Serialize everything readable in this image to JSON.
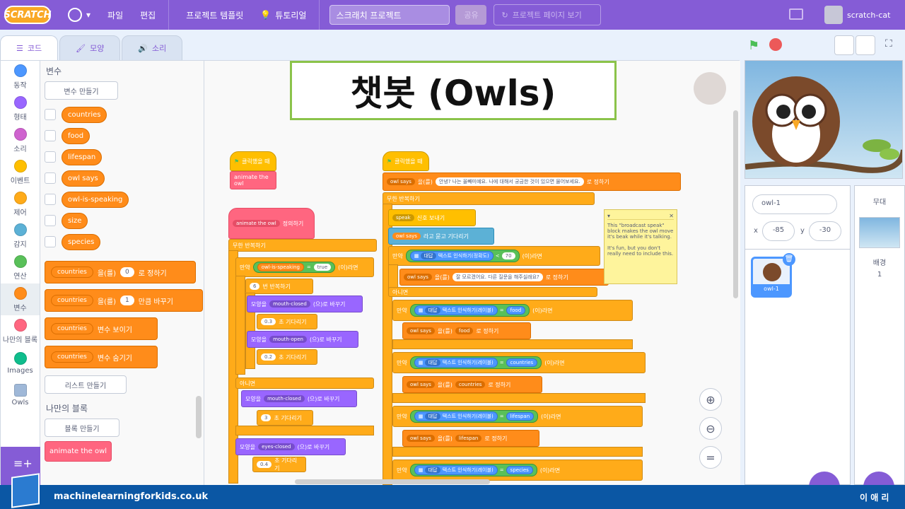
{
  "menubar": {
    "logo": "SCRATCH",
    "file": "파일",
    "edit": "편집",
    "templates": "프로젝트 템플릿",
    "tutorials": "튜토리얼",
    "project_title": "스크래치 프로젝트",
    "share": "공유",
    "see_project": "프로젝트 페이지 보기",
    "username": "scratch-cat"
  },
  "tabs": {
    "code": "코드",
    "costumes": "모양",
    "sounds": "소리"
  },
  "categories": [
    {
      "label": "동작",
      "color": "#4c97ff"
    },
    {
      "label": "형태",
      "color": "#9966ff"
    },
    {
      "label": "소리",
      "color": "#cf63cf"
    },
    {
      "label": "이벤트",
      "color": "#ffbf00"
    },
    {
      "label": "제어",
      "color": "#ffab19"
    },
    {
      "label": "감지",
      "color": "#5cb1d6"
    },
    {
      "label": "연산",
      "color": "#59c059"
    },
    {
      "label": "변수",
      "color": "#ff8c1a"
    },
    {
      "label": "나만의 블록",
      "color": "#ff6680"
    },
    {
      "label": "Images",
      "color": "#0fbd8c"
    },
    {
      "label": "Owls",
      "color": "#9fb8d8"
    }
  ],
  "palette": {
    "heading": "변수",
    "make_variable": "변수 만들기",
    "variables": [
      "countries",
      "food",
      "lifespan",
      "owl says",
      "owl-is-speaking",
      "size",
      "species"
    ],
    "set_var": "countries",
    "set_label": "을(를)",
    "set_value": "0",
    "set_suffix": "로 정하기",
    "change_var": "countries",
    "change_value": "1",
    "change_suffix": "만큼 바꾸기",
    "show_var": "countries",
    "show_suffix": "변수 보이기",
    "hide_var": "countries",
    "hide_suffix": "변수 숨기기",
    "make_list": "리스트 만들기",
    "my_blocks_heading": "나만의 블록",
    "make_block": "블록 만들기",
    "custom_block": "animate the owl"
  },
  "title_card": "챗봇 (Owls)",
  "scripts": {
    "s1_hat": "클릭했을 때",
    "s1_call": "animate the owl",
    "define": "animate the owl",
    "define_suffix": "정의하기",
    "forever1": "무한 반복하기",
    "if": "만약",
    "owl_is_speaking": "owl-is-speaking",
    "true_val": "true",
    "if_suffix": "(이)라면",
    "repeat_n": "6",
    "repeat_label": "번 반복하기",
    "costume_label": "모양을",
    "costume_suffix": "(으)로 바꾸기",
    "mouth_closed": "mouth-closed",
    "mouth_open": "mouth-open",
    "wait1": "0.3",
    "wait_label": "초 기다리기",
    "wait2": "0.2",
    "else": "아니면",
    "mouth_closed2": "mouth-closed",
    "wait3": "3",
    "eyes_closed": "eyes-closed",
    "wait4": "0.4",
    "s2_hat": "클릭했을 때",
    "owl_says": "owl says",
    "to_label": "을(를)",
    "greeting": "안녕? 나는 올빼미예요. 나에 대해서 궁금한 것이 있으면 물어보세요.",
    "set_suffix2": "로 정하기",
    "forever2": "무한 반복하기",
    "broadcast_msg": "speak",
    "broadcast_suffix": "신호 보내기",
    "ask_var": "owl says",
    "ask_suffix": "라고 묻고 기다리기",
    "answer": "대답",
    "recognise_conf": "텍스트 인식하기(정확도)",
    "lt": "<",
    "conf_val": "70",
    "dontknow": "잘 모르겠어요. 다른 질문을 해주실래요?",
    "recognise_label": "텍스트 인식하기(레이블)",
    "eq": "=",
    "labels": [
      "food",
      "countries",
      "lifespan",
      "species"
    ]
  },
  "comment": {
    "text1": "This \"broadcast speak\" block makes the owl move it's beak while it's talking.",
    "text2": "It's fun, but you don't really need to include this."
  },
  "sprite": {
    "name_value": "owl-1",
    "x_label": "x",
    "x_value": "-85",
    "y_label": "y",
    "y_value": "-30",
    "thumb_label": "owl-1"
  },
  "stage_panel": {
    "label": "무대",
    "backdrop_label": "배경",
    "backdrop_count": "1"
  },
  "footer": {
    "site": "machinelearningforkids.co.uk",
    "author": "이 애 리"
  }
}
